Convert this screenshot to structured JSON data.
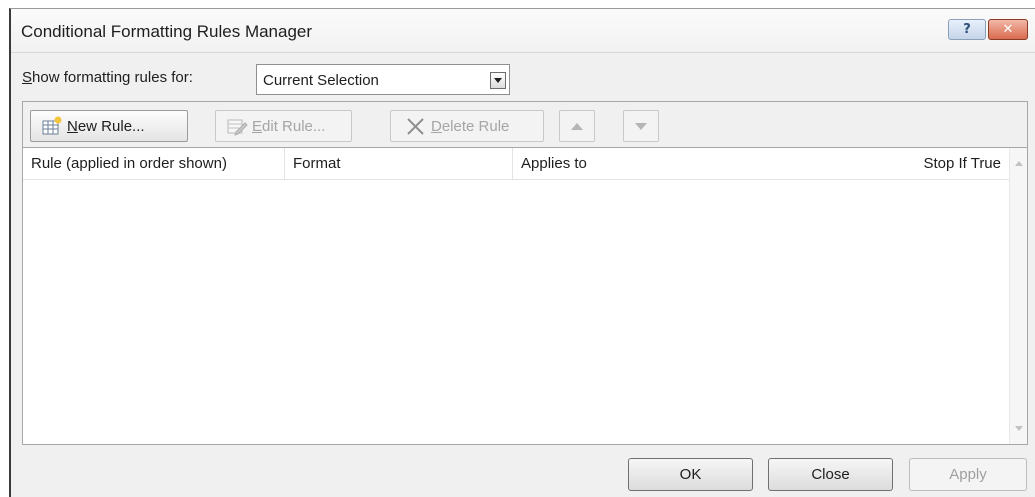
{
  "window": {
    "title": "Conditional Formatting Rules Manager",
    "help_glyph": "?",
    "close_glyph": "✕"
  },
  "scope": {
    "label_accel": "S",
    "label_rest": "how formatting rules for:",
    "selected": "Current Selection"
  },
  "toolbar": {
    "new_rule_accel": "N",
    "new_rule_rest": "ew Rule...",
    "edit_rule_accel": "E",
    "edit_rule_rest": "dit Rule...",
    "delete_rule_accel": "D",
    "delete_rule_rest": "elete Rule",
    "delete_glyph": "✕"
  },
  "table": {
    "columns": [
      "Rule (applied in order shown)",
      "Format",
      "Applies to",
      "Stop If True"
    ],
    "rows": []
  },
  "buttons": {
    "ok": "OK",
    "close": "Close",
    "apply": "Apply"
  }
}
